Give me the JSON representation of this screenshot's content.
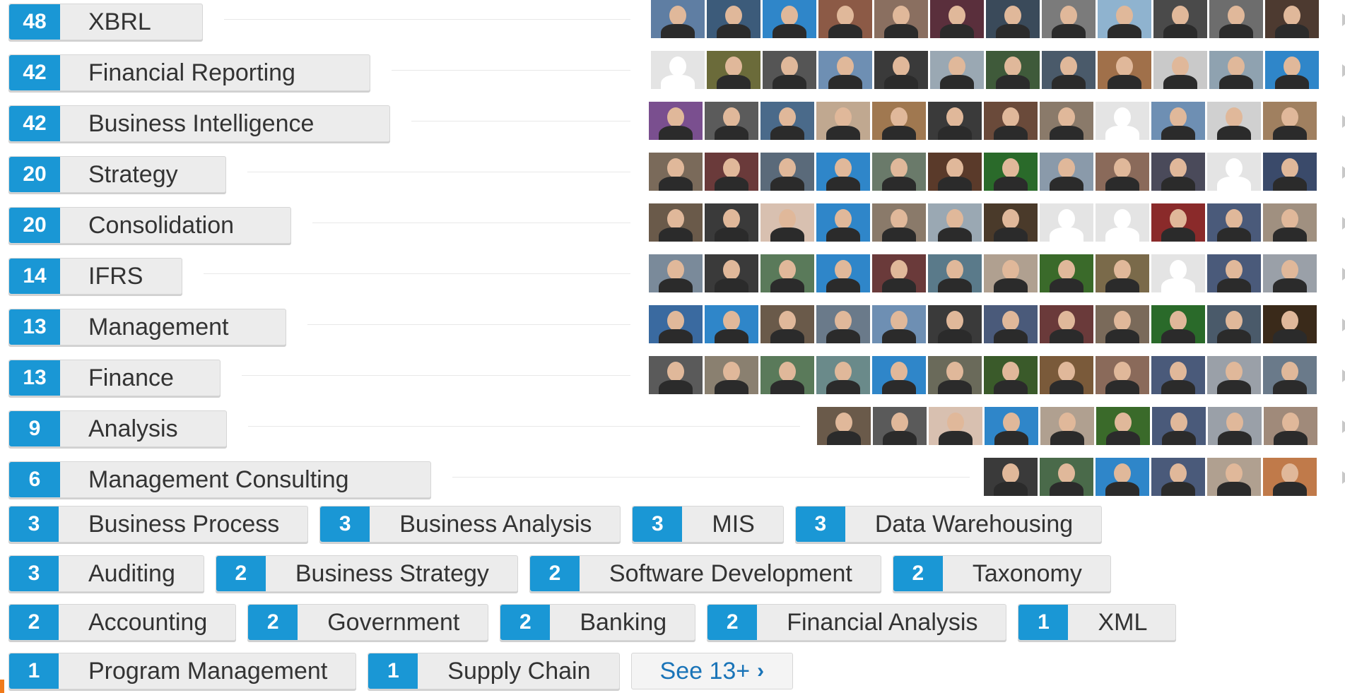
{
  "skills": [
    {
      "count": "48",
      "name": "XBRL",
      "avatars": [
        "#5f7ea3",
        "#3c5b7a",
        "#2f86c9",
        "#8c5a46",
        "#8a6f60",
        "#5a2f3c",
        "#3a4a5a",
        "#7b7b7b",
        "#8fb3cf",
        "#4a4a4a",
        "#6d6d6d",
        "#4d3a30"
      ]
    },
    {
      "count": "42",
      "name": "Financial Reporting",
      "avatars": [
        "blank",
        "#6b6b3a",
        "#555555",
        "#6e8fb3",
        "#3a3a3a",
        "#9aa8b3",
        "#3f5a3a",
        "#4a5a6a",
        "#a0704a",
        "#c9c9c9",
        "#8fa2b0",
        "#2f86c9"
      ]
    },
    {
      "count": "42",
      "name": "Business Intelligence",
      "avatars": [
        "#7a4f8f",
        "#5b5b5b",
        "#4a6a8a",
        "#c0a890",
        "#a07850",
        "#3a3a3a",
        "#6a4a3a",
        "#8a7a6a",
        "blank",
        "#6e8fb3",
        "#d0d0d0",
        "#a08060"
      ]
    },
    {
      "count": "20",
      "name": "Strategy",
      "avatars": [
        "#7a6a5a",
        "#6a3a3a",
        "#5a6a7a",
        "#2f86c9",
        "#6a7a6a",
        "#5a3a2a",
        "#2a6a2a",
        "#8a9aaa",
        "#8a6a5a",
        "#4a4a5a",
        "blank",
        "#3a4a6a"
      ]
    },
    {
      "count": "20",
      "name": "Consolidation",
      "avatars": [
        "#6a5a4a",
        "#3a3a3a",
        "#d8c0b0",
        "#2f86c9",
        "#8a7a6a",
        "#9aa8b3",
        "#4a3a2a",
        "blank",
        "blank",
        "#8a2a2a",
        "#4a5a7a",
        "#a09080"
      ]
    },
    {
      "count": "14",
      "name": "IFRS",
      "avatars": [
        "#7a8a9a",
        "#3a3a3a",
        "#5a7a5a",
        "#2f86c9",
        "#6a3a3a",
        "#5a7a8a",
        "#b0a090",
        "#3a6a2a",
        "#7a6a4a",
        "blank",
        "#4a5a7a",
        "#9aa0a8"
      ]
    },
    {
      "count": "13",
      "name": "Management",
      "avatars": [
        "#3a6aa0",
        "#2f86c9",
        "#6a5a4a",
        "#6a7a8a",
        "#6e8fb3",
        "#3a3a3a",
        "#4a5a7a",
        "#6a3a3a",
        "#7a6a5a",
        "#2a6a2a",
        "#4a5a6a",
        "#3a2a1a"
      ]
    },
    {
      "count": "13",
      "name": "Finance",
      "avatars": [
        "#5a5a5a",
        "#8a8070",
        "#5a7a5a",
        "#6a8a8a",
        "#2f86c9",
        "#6a6a5a",
        "#3a5a2a",
        "#7a5a3a",
        "#8a6a5a",
        "#4a5a7a",
        "#9aa0a8",
        "#6a7a8a"
      ]
    },
    {
      "count": "9",
      "name": "Analysis",
      "avatars": [
        "#6a5a4a",
        "#5a5a5a",
        "#d8c0b0",
        "#2f86c9",
        "#b0a090",
        "#3a6a2a",
        "#4a5a7a",
        "#9aa0a8",
        "#a08a7a"
      ]
    },
    {
      "count": "6",
      "name": "Management Consulting",
      "avatars": [
        "#3a3a3a",
        "#4a6a4a",
        "#2f86c9",
        "#4a5a7a",
        "#b0a090",
        "#c07a4a"
      ]
    }
  ],
  "tag_rows": [
    [
      {
        "count": "3",
        "name": "Business Process"
      },
      {
        "count": "3",
        "name": "Business Analysis"
      },
      {
        "count": "3",
        "name": "MIS"
      },
      {
        "count": "3",
        "name": "Data Warehousing"
      }
    ],
    [
      {
        "count": "3",
        "name": "Auditing"
      },
      {
        "count": "2",
        "name": "Business Strategy"
      },
      {
        "count": "2",
        "name": "Software Development"
      },
      {
        "count": "2",
        "name": "Taxonomy"
      }
    ],
    [
      {
        "count": "2",
        "name": "Accounting"
      },
      {
        "count": "2",
        "name": "Government"
      },
      {
        "count": "2",
        "name": "Banking"
      },
      {
        "count": "2",
        "name": "Financial Analysis"
      },
      {
        "count": "1",
        "name": "XML"
      }
    ],
    [
      {
        "count": "1",
        "name": "Program Management"
      },
      {
        "count": "1",
        "name": "Supply Chain"
      }
    ]
  ],
  "see_more": {
    "label": "See 13+",
    "arrow": "›"
  }
}
